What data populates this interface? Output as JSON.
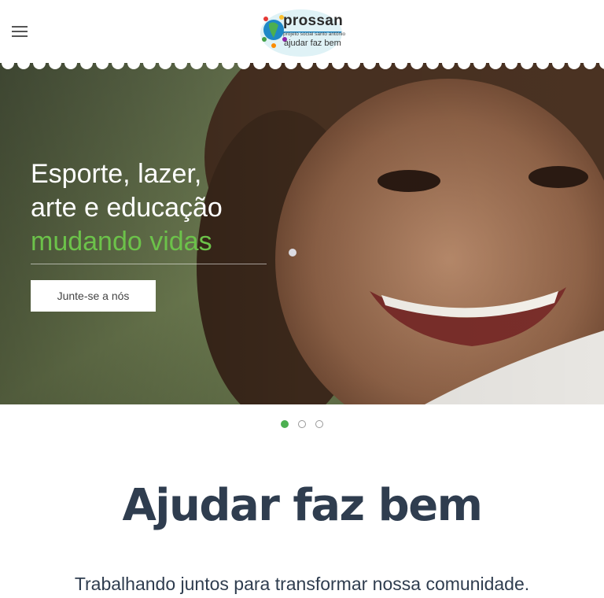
{
  "header": {
    "menu_icon": "hamburger-menu-icon",
    "logo": {
      "title": "prossan",
      "tagline": "projeto social santo antônio",
      "slogan": "ajudar faz bem"
    }
  },
  "hero": {
    "headline_line1": "Esporte, lazer,",
    "headline_line2": "arte e educação",
    "headline_accent": "mudando vidas",
    "cta_label": "Junte-se a nós",
    "accent_color": "#6cc24a"
  },
  "slider": {
    "slide_count": 3,
    "active_index": 0,
    "active_color": "#4caf50"
  },
  "section": {
    "title": "Ajudar faz bem",
    "subtitle": "Trabalhando juntos para transformar nossa comunidade."
  }
}
